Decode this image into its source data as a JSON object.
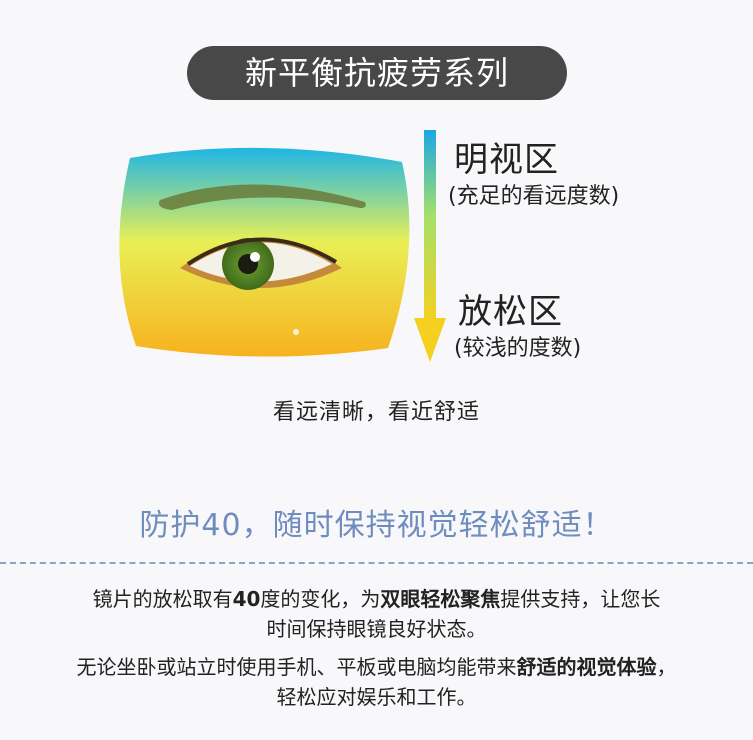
{
  "title": "新平衡抗疲劳系列",
  "zones": {
    "clear": {
      "title": "明视区",
      "subtitle": "(充足的看远度数)"
    },
    "relax": {
      "title": "放松区",
      "subtitle": "(较浅的度数)"
    }
  },
  "caption": "看远清晰，看近舒适",
  "slogan": "防护40，随时保持视觉轻松舒适！",
  "paragraph1": {
    "p1": "镜片的放松取有",
    "b1": "40",
    "p2": "度的变化，为",
    "b2": "双眼轻松聚焦",
    "p3": "提供支持，让您长",
    "line2": "时间保持眼镜良好状态。"
  },
  "paragraph2": {
    "p1": "无论坐卧或站立时使用手机、平板或电脑均能带来",
    "b1": "舒适的视觉体验",
    "p2": "，",
    "line2": "轻松应对娱乐和工作。"
  },
  "colors": {
    "lens_top": "#1fb6e6",
    "lens_bottom": "#f7b21f",
    "arrow_top": "#1aa7e5",
    "arrow_bottom": "#f5d020",
    "slogan": "#6f8cbf",
    "divider": "#8aa3c9",
    "pill": "#484848"
  }
}
